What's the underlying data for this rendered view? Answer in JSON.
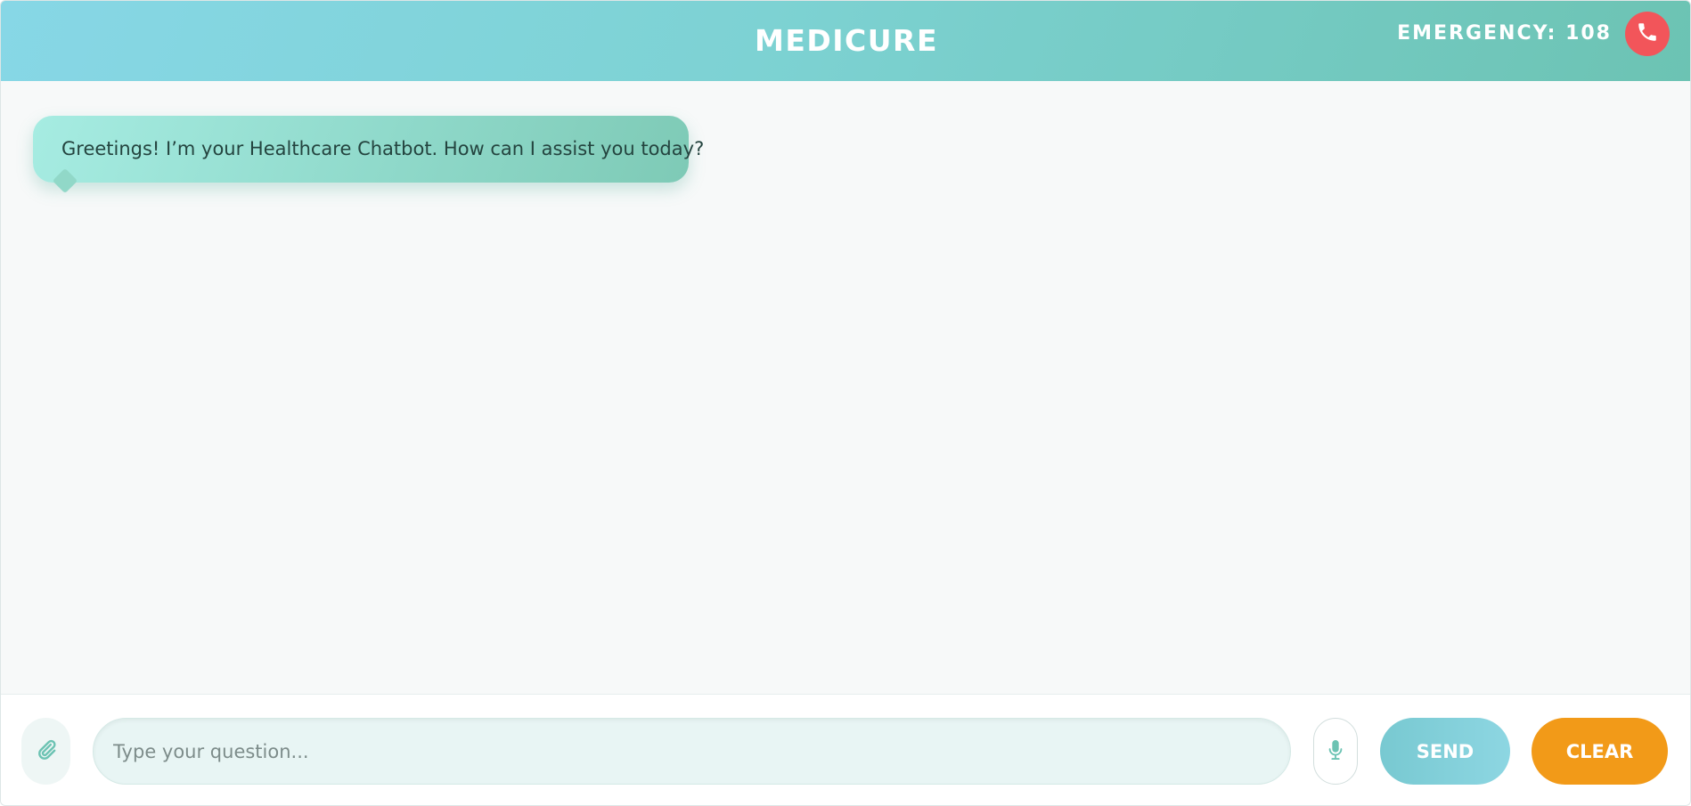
{
  "header": {
    "brand": "MEDICURE",
    "emergency_label": "EMERGENCY: 108"
  },
  "chat": {
    "messages": [
      {
        "sender": "bot",
        "text": "Greetings! I’m your Healthcare Chatbot. How can I assist you today?"
      }
    ]
  },
  "composer": {
    "placeholder": "Type your question...",
    "value": "",
    "send_label": "SEND",
    "clear_label": "CLEAR"
  },
  "icons": {
    "call": "phone-icon",
    "attach": "paperclip-icon",
    "mic": "microphone-icon"
  },
  "colors": {
    "header_gradient_start": "#87d7e6",
    "header_gradient_end": "#6cc3b3",
    "call_button": "#f2555a",
    "bot_bubble": "#8fd9ca",
    "send_button": "#8dd6e2",
    "clear_button": "#f29a18"
  }
}
